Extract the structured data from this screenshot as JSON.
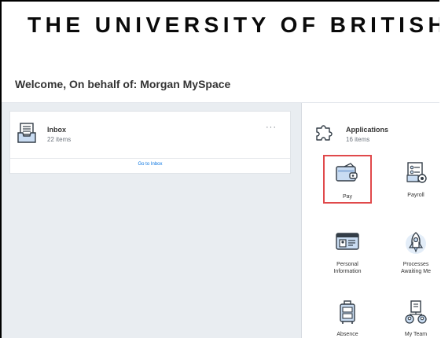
{
  "banner": {
    "title": "THE UNIVERSITY OF BRITISH C"
  },
  "welcome": {
    "text": "Welcome, On behalf of: Morgan MySpace"
  },
  "inbox": {
    "title": "Inbox",
    "count": "22 items",
    "more": "···",
    "go_label": "Go to Inbox"
  },
  "applications": {
    "title": "Applications",
    "count": "16 items",
    "tiles": [
      {
        "label": "Pay",
        "icon": "wallet-icon",
        "selected": true
      },
      {
        "label": "Payroll",
        "icon": "payroll-icon"
      },
      {
        "label_line1": "Personal",
        "label_line2": "Information",
        "icon": "id-card-icon"
      },
      {
        "label_line1": "Processes",
        "label_line2": "Awaiting Me",
        "icon": "rocket-icon"
      },
      {
        "label": "Absence",
        "icon": "luggage-icon"
      },
      {
        "label": "My Team",
        "icon": "team-icon"
      }
    ]
  },
  "colors": {
    "link": "#0875e1",
    "highlight": "#e0494b",
    "icon_blue": "#c9dcf2",
    "icon_dark": "#333d47"
  }
}
